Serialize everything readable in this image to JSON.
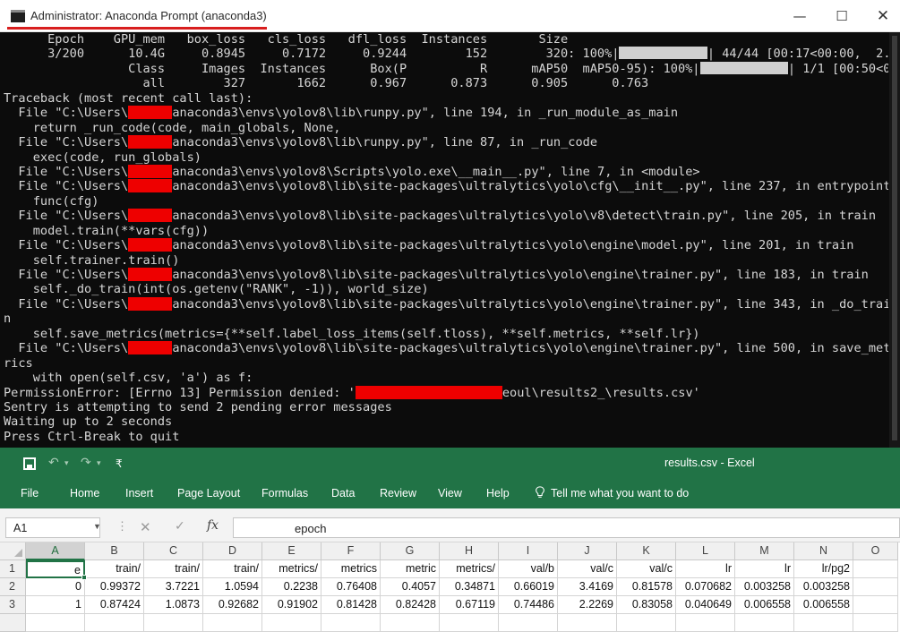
{
  "console": {
    "title": "Administrator: Anaconda Prompt (anaconda3)",
    "window_controls": {
      "minimize": "—",
      "maximize": "☐",
      "close": "✕"
    },
    "lines": [
      {
        "parts": [
          {
            "t": "      Epoch    GPU_mem   box_loss   cls_loss   dfl_loss  Instances       Size"
          }
        ]
      },
      {
        "parts": [
          {
            "t": "      3/200      10.4G     0.8945     0.7172     0.9244        152        320: 100%|"
          },
          {
            "bar": 12
          },
          {
            "t": "| 44/44 [00:17<00:00,  2."
          }
        ]
      },
      {
        "parts": [
          {
            "t": "                 Class     Images  Instances      Box(P          R      mAP50  mAP50-95): 100%|"
          },
          {
            "bar": 12
          },
          {
            "t": "| 1/1 [00:50<0"
          }
        ]
      },
      {
        "parts": [
          {
            "t": "                   all        327       1662      0.967      0.873      0.905      0.763"
          }
        ]
      },
      {
        "parts": [
          {
            "t": "Traceback (most recent call last):"
          }
        ]
      },
      {
        "parts": [
          {
            "t": "  File \"C:\\Users\\"
          },
          {
            "red": 6
          },
          {
            "t": "anaconda3\\envs\\yolov8\\lib\\runpy.py\", line 194, in _run_module_as_main"
          }
        ]
      },
      {
        "parts": [
          {
            "t": "    return _run_code(code, main_globals, None,"
          }
        ]
      },
      {
        "parts": [
          {
            "t": "  File \"C:\\Users\\"
          },
          {
            "red": 6
          },
          {
            "t": "anaconda3\\envs\\yolov8\\lib\\runpy.py\", line 87, in _run_code"
          }
        ]
      },
      {
        "parts": [
          {
            "t": "    exec(code, run_globals)"
          }
        ]
      },
      {
        "parts": [
          {
            "t": "  File \"C:\\Users\\"
          },
          {
            "red": 6
          },
          {
            "t": "anaconda3\\envs\\yolov8\\Scripts\\yolo.exe\\__main__.py\", line 7, in <module>"
          }
        ]
      },
      {
        "parts": [
          {
            "t": "  File \"C:\\Users\\"
          },
          {
            "red": 6
          },
          {
            "t": "anaconda3\\envs\\yolov8\\lib\\site-packages\\ultralytics\\yolo\\cfg\\__init__.py\", line 237, in entrypoint"
          }
        ]
      },
      {
        "parts": [
          {
            "t": "    func(cfg)"
          }
        ]
      },
      {
        "parts": [
          {
            "t": "  File \"C:\\Users\\"
          },
          {
            "red": 6
          },
          {
            "t": "anaconda3\\envs\\yolov8\\lib\\site-packages\\ultralytics\\yolo\\v8\\detect\\train.py\", line 205, in train"
          }
        ]
      },
      {
        "parts": [
          {
            "t": "    model.train(**vars(cfg))"
          }
        ]
      },
      {
        "parts": [
          {
            "t": "  File \"C:\\Users\\"
          },
          {
            "red": 6
          },
          {
            "t": "anaconda3\\envs\\yolov8\\lib\\site-packages\\ultralytics\\yolo\\engine\\model.py\", line 201, in train"
          }
        ]
      },
      {
        "parts": [
          {
            "t": "    self.trainer.train()"
          }
        ]
      },
      {
        "parts": [
          {
            "t": "  File \"C:\\Users\\"
          },
          {
            "red": 6
          },
          {
            "t": "anaconda3\\envs\\yolov8\\lib\\site-packages\\ultralytics\\yolo\\engine\\trainer.py\", line 183, in train"
          }
        ]
      },
      {
        "parts": [
          {
            "t": "    self._do_train(int(os.getenv(\"RANK\", -1)), world_size)"
          }
        ]
      },
      {
        "parts": [
          {
            "t": "  File \"C:\\Users\\"
          },
          {
            "red": 6
          },
          {
            "t": "anaconda3\\envs\\yolov8\\lib\\site-packages\\ultralytics\\yolo\\engine\\trainer.py\", line 343, in _do_trai"
          }
        ]
      },
      {
        "parts": [
          {
            "t": "n"
          }
        ]
      },
      {
        "parts": [
          {
            "t": "    self.save_metrics(metrics={**self.label_loss_items(self.tloss), **self.metrics, **self.lr})"
          }
        ]
      },
      {
        "parts": [
          {
            "t": "  File \"C:\\Users\\"
          },
          {
            "red": 6
          },
          {
            "t": "anaconda3\\envs\\yolov8\\lib\\site-packages\\ultralytics\\yolo\\engine\\trainer.py\", line 500, in save_met"
          }
        ]
      },
      {
        "parts": [
          {
            "t": "rics"
          }
        ]
      },
      {
        "parts": [
          {
            "t": "    with open(self.csv, 'a') as f:"
          }
        ]
      },
      {
        "parts": [
          {
            "t": "PermissionError: [Errno 13] Permission denied: '"
          },
          {
            "red": 20
          },
          {
            "t": "eoul\\results2_\\results.csv'"
          }
        ]
      },
      {
        "parts": [
          {
            "t": "Sentry is attempting to send 2 pending error messages"
          }
        ]
      },
      {
        "parts": [
          {
            "t": "Waiting up to 2 seconds"
          }
        ]
      },
      {
        "parts": [
          {
            "t": "Press Ctrl-Break to quit"
          }
        ]
      }
    ]
  },
  "excel": {
    "filename": "results.csv  -  Excel",
    "quick_access": {
      "undo": "↶",
      "redo": "↷",
      "sep": "▾",
      "customize": "₹"
    },
    "tabs": [
      "File",
      "Home",
      "Insert",
      "Page Layout",
      "Formulas",
      "Data",
      "Review",
      "View",
      "Help"
    ],
    "tell_me": "Tell me what you want to do",
    "tell_me_icon": "lightbulb-icon",
    "name_box": "A1",
    "formula_cancel": "✕",
    "formula_enter": "✓",
    "formula_fx": "fx",
    "formula_value": "epoch",
    "columns": [
      "A",
      "B",
      "C",
      "D",
      "E",
      "F",
      "G",
      "H",
      "I",
      "J",
      "K",
      "L",
      "M",
      "N",
      "O"
    ],
    "selected_column": "A",
    "rows": [
      {
        "num": "1",
        "cells": [
          "e",
          "train/",
          "train/",
          "train/",
          "metrics/",
          "metrics",
          "metric",
          "metrics/",
          "val/b",
          "val/c",
          "val/c",
          "lr",
          "lr",
          "lr/pg2",
          ""
        ]
      },
      {
        "num": "2",
        "cells": [
          "0",
          "0.99372",
          "3.7221",
          "1.0594",
          "0.2238",
          "0.76408",
          "0.4057",
          "0.34871",
          "0.66019",
          "3.4169",
          "0.81578",
          "0.070682",
          "0.003258",
          "0.003258",
          ""
        ]
      },
      {
        "num": "3",
        "cells": [
          "1",
          "0.87424",
          "1.0873",
          "0.92682",
          "0.91902",
          "0.81428",
          "0.82428",
          "0.67119",
          "0.74486",
          "2.2269",
          "0.83058",
          "0.040649",
          "0.006558",
          "0.006558",
          ""
        ]
      }
    ]
  }
}
